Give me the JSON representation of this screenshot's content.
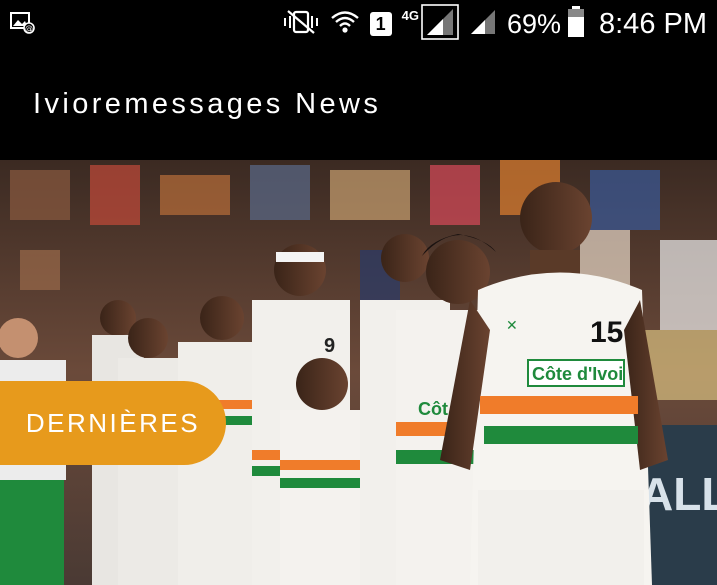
{
  "status_bar": {
    "left_icon": "screenshot-notification-icon",
    "icons": [
      "vibrate-mute-icon",
      "wifi-icon",
      "sim-1-icon",
      "signal-4g-icon",
      "signal-icon",
      "battery-icon"
    ],
    "sim_slot": "1",
    "network_type": "4G",
    "battery_percent": "69%",
    "time": "8:46 PM"
  },
  "app_bar": {
    "title": "Ivioremessages News"
  },
  "hero": {
    "category_label": "DERNIÈRES",
    "image_description": "basketball-team-photo",
    "jersey_text": "Côte d'Ivoire",
    "jersey_number": "15",
    "colors": {
      "pill": "#e79a1c",
      "jersey": "#f2f0ec",
      "orange_stripe": "#f07c2a",
      "green_stripe": "#1f8a3c"
    }
  }
}
